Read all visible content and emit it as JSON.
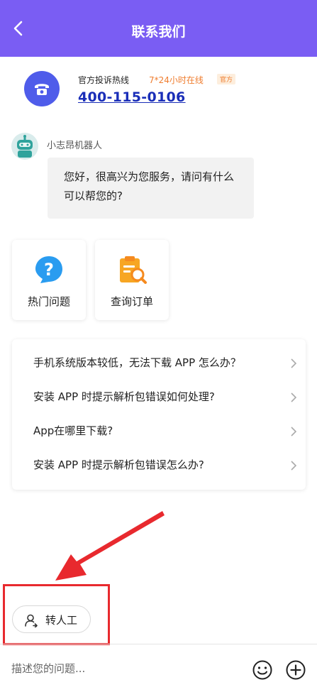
{
  "header": {
    "title": "联系我们"
  },
  "hotline": {
    "label": "官方投诉热线",
    "hours": "7*24小时在线",
    "badge": "官方",
    "number": "400-115-0106"
  },
  "bot": {
    "name": "小志昂机器人",
    "message": "您好，很高兴为您服务，请问有什么可以帮您的?"
  },
  "quick_actions": [
    {
      "label": "热门问题",
      "icon": "question-icon"
    },
    {
      "label": "查询订单",
      "icon": "order-search-icon"
    }
  ],
  "faq": [
    "手机系统版本较低，无法下载 APP 怎么办？",
    "安装 APP 时提示解析包错误如何处理?",
    "App在哪里下载?",
    "安装 APP 时提示解析包错误怎么办?"
  ],
  "human_button": {
    "label": "转人工",
    "icon": "agent-icon"
  },
  "composer": {
    "placeholder": "描述您的问题..."
  },
  "colors": {
    "header": "#7a5df3",
    "hotline_number": "#1a2eb8",
    "accent_orange": "#ef7d2f",
    "annotation_red": "#e8292e"
  }
}
